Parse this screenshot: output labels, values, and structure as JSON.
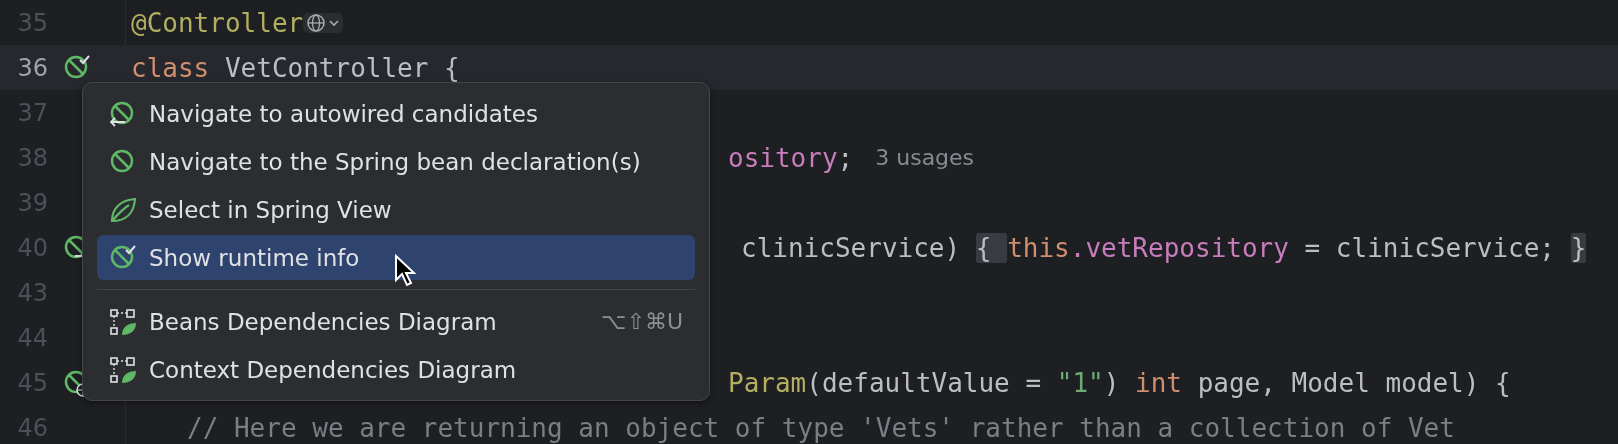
{
  "editor": {
    "lines": [
      {
        "number": "35",
        "current": false,
        "segments": [
          {
            "kind": "annotation",
            "text": "@Controller"
          },
          {
            "kind": "globe-inlay"
          }
        ]
      },
      {
        "number": "36",
        "current": true,
        "gutter_marker": {
          "kind": "bean-check"
        },
        "segments": [
          {
            "kind": "keyword",
            "text": "class"
          },
          {
            "kind": "plain",
            "text": " VetController {"
          }
        ]
      },
      {
        "number": "37",
        "current": false
      },
      {
        "number": "38",
        "current": false,
        "segments": [
          {
            "kind": "field",
            "text": "ository"
          },
          {
            "kind": "plain",
            "text": ";"
          },
          {
            "kind": "hint",
            "text": "3 usages"
          }
        ]
      },
      {
        "number": "39",
        "current": false
      },
      {
        "number": "40",
        "current": false,
        "gutter_marker": {
          "kind": "bean-arrow"
        },
        "segments": [
          {
            "kind": "plain",
            "text": "clinicService) "
          },
          {
            "kind": "brace",
            "text": "{ "
          },
          {
            "kind": "keyword",
            "text": "this"
          },
          {
            "kind": "field",
            "text": ".vetRepository"
          },
          {
            "kind": "plain",
            "text": " = clinicService; "
          },
          {
            "kind": "brace",
            "text": "}"
          }
        ]
      },
      {
        "number": "43",
        "current": false
      },
      {
        "number": "44",
        "current": false
      },
      {
        "number": "45",
        "current": false,
        "gutter_marker": {
          "kind": "bean-globe"
        },
        "segments": [
          {
            "kind": "annotation",
            "text": "Param"
          },
          {
            "kind": "plain",
            "text": "(defaultValue = "
          },
          {
            "kind": "string",
            "text": "\"1\""
          },
          {
            "kind": "plain",
            "text": ") "
          },
          {
            "kind": "keyword",
            "text": "int"
          },
          {
            "kind": "plain",
            "text": " page, Model model) {"
          }
        ]
      },
      {
        "number": "46",
        "current": false,
        "segments": [
          {
            "kind": "comment",
            "text": "// Here we are returning an object of type 'Vets' rather than a collection of Vet"
          }
        ]
      }
    ]
  },
  "popup_menu": {
    "items": [
      {
        "kind": "autowired",
        "label": "Navigate to autowired candidates",
        "selected": false
      },
      {
        "kind": "bean",
        "label": "Navigate to the Spring bean declaration(s)",
        "selected": false
      },
      {
        "kind": "leaf",
        "label": "Select in Spring View",
        "selected": false
      },
      {
        "kind": "runtime",
        "label": "Show runtime info",
        "selected": true
      },
      {
        "kind": "separator"
      },
      {
        "kind": "diagram",
        "label": "Beans Dependencies Diagram",
        "shortcut": "⌥⇧⌘U",
        "selected": false
      },
      {
        "kind": "diagram",
        "label": "Context Dependencies Diagram",
        "selected": false
      }
    ]
  }
}
